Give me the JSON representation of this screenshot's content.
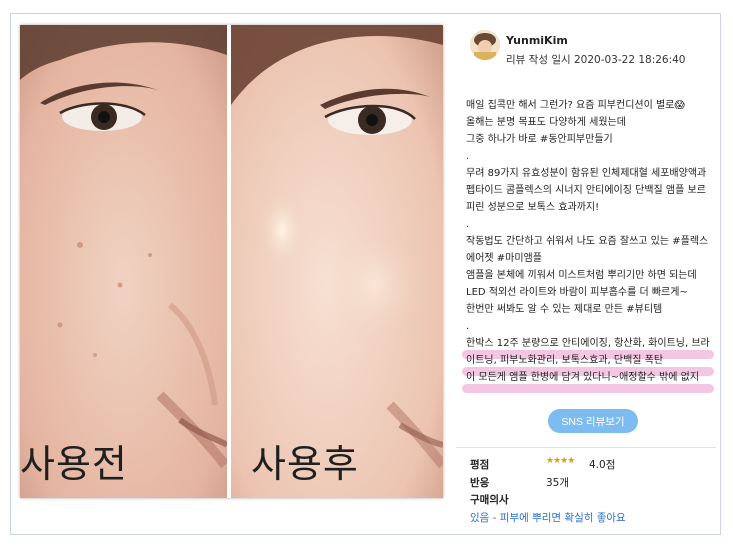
{
  "photo": {
    "before_label": "사용전",
    "after_label": "사용후"
  },
  "review": {
    "username": "YunmiKim",
    "date_line": "리뷰 작성 일시 2020-03-22 18:26:40",
    "body": "매일 집콕만 해서 그런가? 요즘 피부컨디션이 별로😱\n올해는 분명 목표도 다양하게 세웠는데\n그중 하나가 바로 #동안피부만들기\n.\n무려 89가지 유효성분이 함유된 인체제대혈 세포배양액과\n펩타이드 콤플렉스의 시너지 안티에이징 단백질 앰플 보르피린 성분으로 보톡스 효과까지!\n.\n작동법도 간단하고 쉬워서 나도 요즘 잘쓰고 있는 #플렉스에어젯 #마미앰플\n앰플을 본체에 끼워서 미스트처럼 뿌리기만 하면 되는데\nLED 적외선 라이트와 바람이 피부흡수를 더 빠르게~\n한번만 써봐도 알 수 있는 제대로 만든 #뷰티템\n.\n한박스 12주 분량으로 안티에이징, 항산화, 화이트닝, 브라이트닝, 피부노화관리, 보톡스효과, 단백질 폭탄\n이 모든게 앰플 한병에 담겨 있다니~애정할수 밖에 없지"
  },
  "sns_button_label": "SNS 리뷰보기",
  "meta": {
    "rating_label": "평점",
    "rating_stars": "★★★★",
    "rating_value": "4.0점",
    "replies_label": "반응",
    "replies_value": "35개",
    "purchase_label": "구매의사",
    "purchase_value": "있음 - 피부에 뿌리면 확실히 좋아요"
  },
  "colors": {
    "button": "#7cbcf0",
    "highlight": "#f3c6e3",
    "purchase_link": "#2a6fd1"
  }
}
